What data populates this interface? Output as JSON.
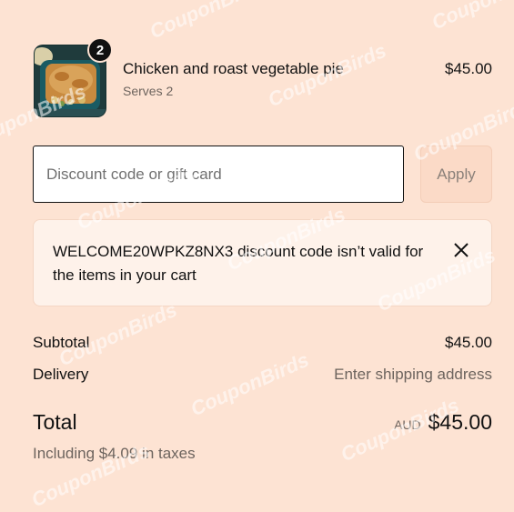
{
  "item": {
    "quantity": "2",
    "name": "Chicken and roast vegetable pie",
    "subtitle": "Serves 2",
    "price": "$45.00"
  },
  "discount": {
    "placeholder": "Discount code or gift card",
    "value": "",
    "apply_label": "Apply"
  },
  "error": {
    "message": "WELCOME20WPKZ8NX3 discount code isn’t valid for the items in your cart"
  },
  "summary": {
    "subtotal_label": "Subtotal",
    "subtotal_value": "$45.00",
    "delivery_label": "Delivery",
    "delivery_value": "Enter shipping address",
    "total_label": "Total",
    "currency": "AUD",
    "total_value": "$45.00",
    "taxes_note": "Including $4.09 in taxes"
  },
  "watermark": "CouponBirds",
  "colors": {
    "background": "#fde3d3",
    "error_bg": "#fef2ea",
    "apply_bg": "#fbdac7"
  }
}
